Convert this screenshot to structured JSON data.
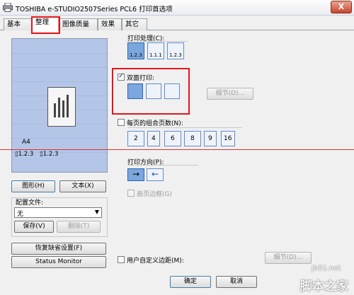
{
  "window": {
    "title": "TOSHIBA e-STUDIO2507Series PCL6 打印首选项",
    "close_glyph": "X"
  },
  "tabs": [
    {
      "label": "基本",
      "active": false
    },
    {
      "label": "整理",
      "active": true
    },
    {
      "label": "图像质量",
      "active": false
    },
    {
      "label": "效果",
      "active": false
    },
    {
      "label": "其它",
      "active": false
    }
  ],
  "preview": {
    "paper_size": "A4",
    "collate_label_1": "1.2.3",
    "collate_label_2": "1.2.3"
  },
  "view_buttons": {
    "graphic": "图形(H)",
    "text": "文本(X)"
  },
  "profile": {
    "label": "配置文件:",
    "selected": "无",
    "save": "保存(V)",
    "delete": "删除(T)"
  },
  "restore_defaults": "恢复缺省设置(F)",
  "status_monitor": "Status Monitor",
  "print_processing": {
    "label": "打印处理(C):",
    "options": [
      "1.2.3",
      "1.1.1",
      "1.2.3"
    ]
  },
  "duplex": {
    "label": "双面打印:",
    "checked": true,
    "detail_button": "细节(D)..."
  },
  "pages_per_sheet": {
    "label": "每页的组合页数(N):",
    "checked": false,
    "options": [
      "2",
      "4",
      "6",
      "8",
      "9",
      "16"
    ]
  },
  "orientation": {
    "label": "打印方向(P):",
    "arrows": [
      "→",
      "←"
    ],
    "page_border": "画页边框(G)"
  },
  "custom_margin": {
    "label": "用户自定义边距(M):",
    "checked": false,
    "detail_button": "细节(D)..."
  },
  "footer": {
    "ok": "确定",
    "cancel": "取消"
  },
  "watermark": {
    "line1": "jb51.net",
    "line2": "脚本之家"
  },
  "colors": {
    "highlight_box": "#e0161c",
    "selected_icon": "#7aa7de",
    "preview_bg": "#b4c6e8"
  }
}
